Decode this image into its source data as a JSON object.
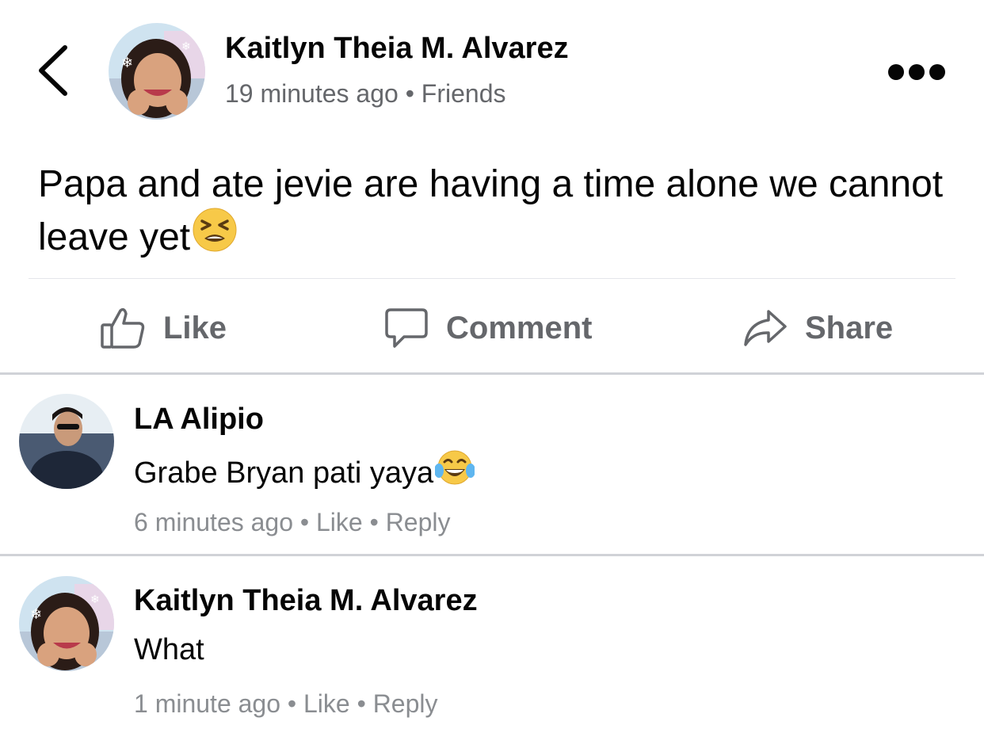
{
  "post": {
    "author": "Kaitlyn Theia M. Alvarez",
    "time": "19 minutes ago",
    "separator": " • ",
    "audience": "Friends",
    "text": "Papa and ate jevie are having a time alone we cannot leave yet",
    "text_emoji": "tired-face-emoji"
  },
  "actions": {
    "like": "Like",
    "comment": "Comment",
    "share": "Share"
  },
  "comments": [
    {
      "author": "LA Alipio",
      "text": "Grabe Bryan pati yaya",
      "text_emoji": "tears-of-joy-emoji",
      "time": "6 minutes ago",
      "like": "Like",
      "reply": "Reply"
    },
    {
      "author": "Kaitlyn Theia M. Alvarez",
      "text": "What",
      "time": "1 minute ago",
      "like": "Like",
      "reply": "Reply"
    }
  ],
  "colors": {
    "text_primary": "#050505",
    "text_secondary": "#65676b",
    "divider": "#d0d2d7"
  }
}
